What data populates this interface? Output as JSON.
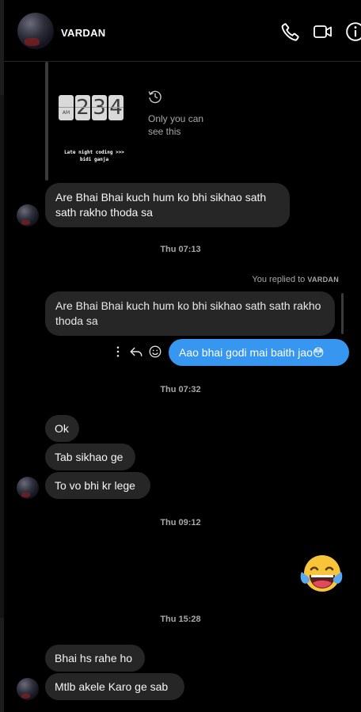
{
  "header": {
    "contact_name": "VARDAN",
    "icons": [
      "phone-icon",
      "video-icon",
      "info-icon"
    ]
  },
  "story": {
    "clock_digits": [
      "",
      "2",
      "3",
      "4"
    ],
    "clock_ampm": "AM",
    "caption_line1": "Late night coding >>>",
    "caption_line2": "bidi ganja",
    "note_line1": "Only you can",
    "note_line2": "see this"
  },
  "messages": {
    "m1": "Are Bhai Bhai kuch hum ko bhi sikhao sath sath rakho thoda sa",
    "ts1": "Thu 07:13",
    "replied_prefix": "You replied to ",
    "replied_name": "VARDAN",
    "quoted": "Are Bhai Bhai kuch hum ko bhi sikhao sath sath rakho thoda sa",
    "reply": "Aao bhai godi mai baith jao",
    "reply_emoji": "😳",
    "ts2": "Thu 07:32",
    "m2": "Ok",
    "m3": "Tab sikhao ge",
    "m4": "To vo bhi kr lege",
    "ts3": "Thu 09:12",
    "big_emoji": "laughing-tears",
    "ts4": "Thu 15:28",
    "m5": "Bhai hs rahe ho",
    "m6": "Mtlb akele Karo ge sab"
  },
  "colors": {
    "background": "#000000",
    "incoming_bubble": "#262626",
    "outgoing_bubble": "#3797f0",
    "muted_text": "#a8a8a8"
  }
}
